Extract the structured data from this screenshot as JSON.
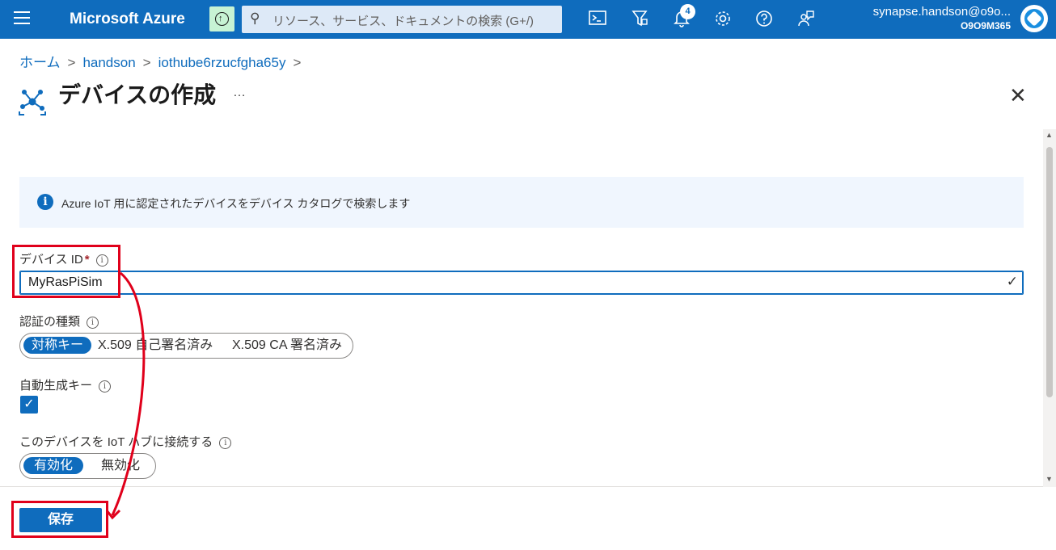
{
  "topbar": {
    "brand": "Microsoft Azure",
    "search_placeholder": "リソース、サービス、ドキュメントの検索 (G+/)",
    "notification_count": "4",
    "user_email": "synapse.handson@o9o...",
    "user_tenant": "O9O9M365",
    "icons": [
      "menu-icon",
      "upload-icon",
      "search-icon",
      "cloud-shell-icon",
      "directory-filter-icon",
      "bell-icon",
      "gear-icon",
      "help-icon",
      "feedback-icon",
      "avatar"
    ]
  },
  "breadcrumb": {
    "items": [
      "ホーム",
      "handson",
      "iothube6rzucfgha65y"
    ],
    "separator": ">"
  },
  "page": {
    "title": "デバイスの作成",
    "more": "…",
    "close": "✕"
  },
  "info": {
    "text": "Azure IoT 用に認定されたデバイスをデバイス カタログで検索します"
  },
  "form": {
    "device_id_label": "デバイス ID",
    "required_mark": "*",
    "device_id_value": "MyRasPiSim",
    "auth_type_label": "認証の種類",
    "auth_options": [
      "対称キー",
      "X.509 自己署名済み",
      "X.509 CA 署名済み"
    ],
    "auth_selected": "対称キー",
    "auto_key_label": "自動生成キー",
    "auto_key_checked": true,
    "connect_label": "このデバイスを IoT ハブに接続する",
    "connect_options": [
      "有効化",
      "無効化"
    ],
    "connect_selected": "有効化",
    "save_label": "保存"
  },
  "colors": {
    "accent": "#0f6cbd",
    "highlight": "#e0001b",
    "info_bg": "#f0f6fe"
  }
}
